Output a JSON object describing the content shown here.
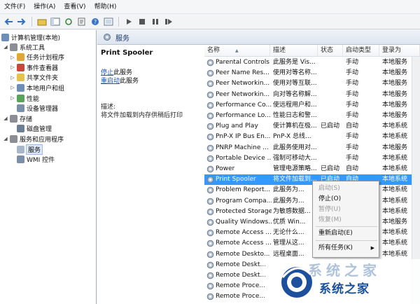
{
  "menubar": {
    "items": [
      "文件(F)",
      "操作(A)",
      "查看(V)",
      "帮助(H)"
    ]
  },
  "toolbar": {
    "icons": [
      "back-icon",
      "forward-icon",
      "up-icon",
      "show-tree-icon",
      "refresh-icon",
      "export-icon",
      "help-icon",
      "properties-icon",
      "play-icon",
      "stop-icon",
      "pause-icon",
      "restart-icon"
    ]
  },
  "tree": {
    "root": "计算机管理(本地)",
    "items": [
      {
        "label": "系统工具",
        "level": 1,
        "expanded": true
      },
      {
        "label": "任务计划程序",
        "level": 2
      },
      {
        "label": "事件查看器",
        "level": 2
      },
      {
        "label": "共享文件夹",
        "level": 2
      },
      {
        "label": "本地用户和组",
        "level": 2
      },
      {
        "label": "性能",
        "level": 2
      },
      {
        "label": "设备管理器",
        "level": 2
      },
      {
        "label": "存储",
        "level": 1,
        "expanded": true
      },
      {
        "label": "磁盘管理",
        "level": 2
      },
      {
        "label": "服务和应用程序",
        "level": 1,
        "expanded": true
      },
      {
        "label": "服务",
        "level": 2,
        "selected": true
      },
      {
        "label": "WMI 控件",
        "level": 2
      }
    ]
  },
  "services_header": "服务",
  "detail": {
    "title": "Print Spooler",
    "stop_link": "停止",
    "stop_suffix": "此服务",
    "restart_link": "重启动",
    "restart_suffix": "此服务",
    "desc_label": "描述:",
    "desc_text": "将文件加载到内存供稍后打印"
  },
  "columns": [
    "名称",
    "描述",
    "状态",
    "启动类型",
    "登录为"
  ],
  "rows": [
    {
      "name": "Parental Controls",
      "desc": "此服务是 Vis...",
      "status": "",
      "startup": "手动",
      "logon": "本地服务"
    },
    {
      "name": "Peer Name Res...",
      "desc": "使用对等名称...",
      "status": "",
      "startup": "手动",
      "logon": "本地服务"
    },
    {
      "name": "Peer Networkin...",
      "desc": "使用对等互联...",
      "status": "",
      "startup": "手动",
      "logon": "本地服务"
    },
    {
      "name": "Peer Networkin...",
      "desc": "向对等名称解...",
      "status": "",
      "startup": "手动",
      "logon": "本地服务"
    },
    {
      "name": "Performance Co...",
      "desc": "使远程用户和...",
      "status": "",
      "startup": "手动",
      "logon": "本地服务"
    },
    {
      "name": "Performance Lo...",
      "desc": "性能日志和警...",
      "status": "",
      "startup": "手动",
      "logon": "本地服务"
    },
    {
      "name": "Plug and Play",
      "desc": "使计算机在极...",
      "status": "已启动",
      "startup": "自动",
      "logon": "本地系统"
    },
    {
      "name": "PnP-X IP Bus En...",
      "desc": "PnP-X 总线...",
      "status": "",
      "startup": "手动",
      "logon": "本地系统"
    },
    {
      "name": "PNRP Machine ...",
      "desc": "此服务使用对...",
      "status": "",
      "startup": "手动",
      "logon": "本地服务"
    },
    {
      "name": "Portable Device ...",
      "desc": "强制可移动大...",
      "status": "",
      "startup": "手动",
      "logon": "本地系统"
    },
    {
      "name": "Power",
      "desc": "管理电源策略...",
      "status": "已启动",
      "startup": "自动",
      "logon": "本地系统"
    },
    {
      "name": "Print Spooler",
      "desc": "将文件加载到...",
      "status": "已启动",
      "startup": "自动",
      "logon": "本地系统",
      "selected": true
    },
    {
      "name": "Problem Report...",
      "desc": "此服务为...",
      "status": "",
      "startup": "",
      "logon": "本地系统"
    },
    {
      "name": "Program Compa...",
      "desc": "此服务为...",
      "status": "",
      "startup": "",
      "logon": "本地系统"
    },
    {
      "name": "Protected Storage",
      "desc": "为敏感数据...",
      "status": "",
      "startup": "",
      "logon": "本地系统"
    },
    {
      "name": "Quality Windows...",
      "desc": "优质 Win...",
      "status": "",
      "startup": "",
      "logon": "本地服务"
    },
    {
      "name": "Remote Access ...",
      "desc": "无论什么...",
      "status": "",
      "startup": "",
      "logon": "本地系统"
    },
    {
      "name": "Remote Access ...",
      "desc": "管理从这...",
      "status": "",
      "startup": "",
      "logon": "本地系统"
    },
    {
      "name": "Remote Deskto...",
      "desc": "远程桌面...",
      "status": "",
      "startup": "",
      "logon": "本地系统"
    },
    {
      "name": "Remote Deskt...",
      "desc": "",
      "status": "",
      "startup": "",
      "logon": ""
    },
    {
      "name": "Remote Deskt...",
      "desc": "",
      "status": "",
      "startup": "",
      "logon": ""
    },
    {
      "name": "Remote Proce...",
      "desc": "",
      "status": "",
      "startup": "",
      "logon": ""
    },
    {
      "name": "Remote Proce...",
      "desc": "",
      "status": "",
      "startup": "",
      "logon": ""
    }
  ],
  "context_menu": {
    "items": [
      {
        "label": "启动(S)",
        "disabled": true
      },
      {
        "label": "停止(O)",
        "disabled": false
      },
      {
        "label": "暂停(U)",
        "disabled": true
      },
      {
        "label": "恢复(M)",
        "disabled": true
      },
      {
        "label": "重新启动(E)",
        "disabled": false
      },
      {
        "label": "所有任务(K)",
        "disabled": false,
        "submenu": true
      }
    ]
  },
  "watermark": {
    "text": "系统之家",
    "faint": "系统之家"
  },
  "colors": {
    "selection": "#3399ff",
    "link": "#1c55b8"
  }
}
